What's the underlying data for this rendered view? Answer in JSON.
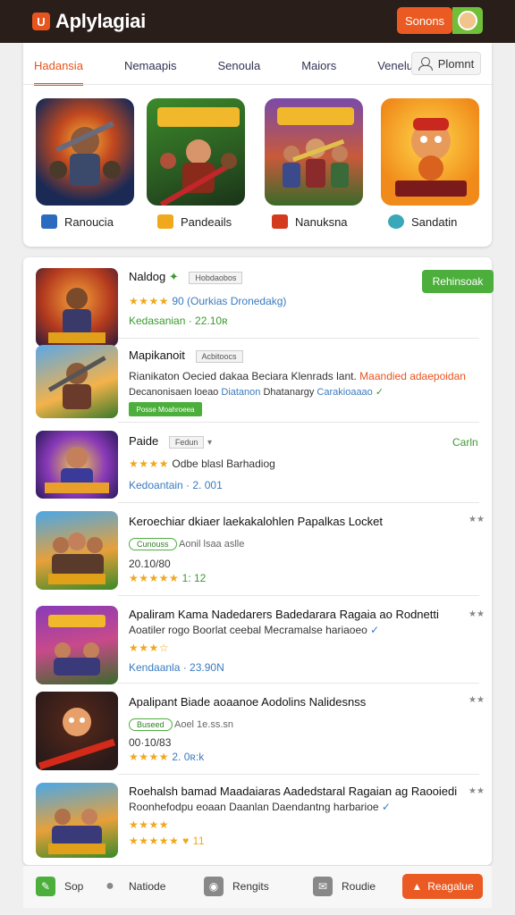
{
  "header": {
    "title": "Aplylagiai",
    "button_label": "Sonons"
  },
  "tabs": [
    "Hadansia",
    "Nemaapis",
    "Senoula",
    "Maiors",
    "Venelur"
  ],
  "profile_button": "Plomnt",
  "featured": [
    {
      "label": "Ranoucia",
      "art": "featured-game-art-1"
    },
    {
      "label": "Pandeails",
      "art": "featured-game-art-2"
    },
    {
      "label": "Nanuksna",
      "art": "featured-game-art-3"
    },
    {
      "label": "Sandatin",
      "art": "featured-game-art-4"
    }
  ],
  "list": [
    {
      "title": "Naldog",
      "tag": "Hobdaobos",
      "stars": "★★★★",
      "line2": "90 (Ourkias Dronedakg)",
      "line3": "Kedasanian · 22.10ʀ",
      "button": "Rehinsoak"
    },
    {
      "title": "Mapikanoit",
      "tag": "Acbitoocs",
      "line2": "Rianikaton Oecied dakaa Beciara Klenrads lant.",
      "line2b": "Maandied adaepoidan",
      "line3": "Decanonisaen loeao",
      "line3b": "Diatanon",
      "line3c": "Dhatanargy",
      "line3d": "Carakioaaao",
      "bar": "Posse Moahroeea"
    },
    {
      "title": "Paide",
      "tag": "Fedun",
      "stars": "★★★★",
      "line2": "Odbe blasl Barhadiog",
      "line3": "Kedoantain · 2. 001",
      "link": "Carln"
    },
    {
      "title": "Keroechiar dkiaer laekakalohlen Papalkas Locket",
      "pill": "Cunouss",
      "line2b": "Aonil lsaa aslle",
      "line3": "20.10/80",
      "stars": "★★★★★",
      "rating_suffix": "1: 12"
    },
    {
      "title": "Apaliram Kama Nadedarers Badedarara Ragaia ao Rodnetti",
      "line2": "Aoatiler rogo Boorlat ceebal Mecramalse hariaoeo",
      "stars": "★★★☆",
      "line3": "Kendaanla · 23.90N"
    },
    {
      "title": "Apalipant Biade aoaanoe Aodolins Nalidesnss",
      "pill": "Buseed",
      "line2b": "Aoel 1e.ss.sn",
      "line3": "00·10/83",
      "stars": "★★★★",
      "rating_suffix": "2. 0ʀ:k"
    },
    {
      "title": "Roehalsh bamad Maadaiaras Aadedstaral Ragaian ag Raooiedi",
      "line2": "Roonhefodpu eoaan Daanlan Daendantng harbarioe",
      "stars": "★★★★",
      "line3": "★★★★★ ♥ 11"
    }
  ],
  "bottom_nav": [
    {
      "label": "Sop",
      "icon": "leaf-icon"
    },
    {
      "label": "Natiode",
      "icon": "person-icon"
    },
    {
      "label": "Rengits",
      "icon": "gamepad-icon"
    },
    {
      "label": "Roudie",
      "icon": "chat-icon"
    }
  ],
  "bottom_cta": "Reagalue",
  "colors": {
    "accent": "#e8541e",
    "green": "#4caf3c",
    "header_bg": "#2a1e1a"
  }
}
